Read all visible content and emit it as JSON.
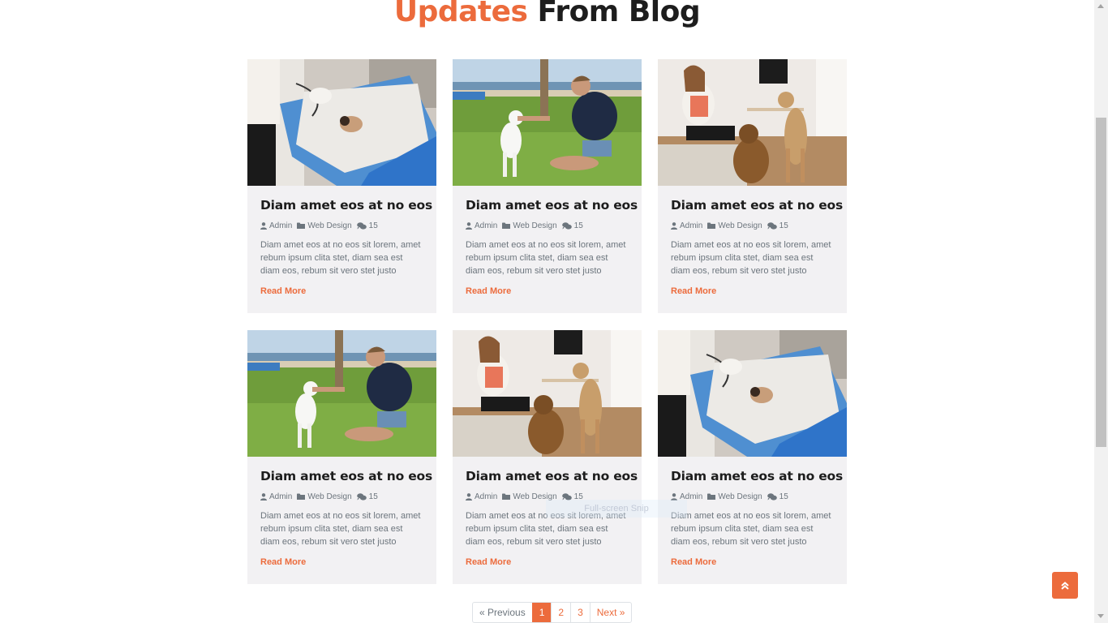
{
  "section": {
    "title_accent": "Updates",
    "title_rest": "From Blog"
  },
  "posts": [
    {
      "image": "vet-puppy",
      "title": "Diam amet eos at no eos",
      "author": "Admin",
      "category": "Web Design",
      "comments": "15",
      "excerpt": "Diam amet eos at no eos sit lorem, amet rebum ipsum clita stet, diam sea est diam eos, rebum sit vero stet justo",
      "link": "Read More"
    },
    {
      "image": "man-dog-beach",
      "title": "Diam amet eos at no eos",
      "author": "Admin",
      "category": "Web Design",
      "comments": "15",
      "excerpt": "Diam amet eos at no eos sit lorem, amet rebum ipsum clita stet, diam sea est diam eos, rebum sit vero stet justo",
      "link": "Read More"
    },
    {
      "image": "woman-dogs-room",
      "title": "Diam amet eos at no eos",
      "author": "Admin",
      "category": "Web Design",
      "comments": "15",
      "excerpt": "Diam amet eos at no eos sit lorem, amet rebum ipsum clita stet, diam sea est diam eos, rebum sit vero stet justo",
      "link": "Read More"
    },
    {
      "image": "man-dog-beach",
      "title": "Diam amet eos at no eos",
      "author": "Admin",
      "category": "Web Design",
      "comments": "15",
      "excerpt": "Diam amet eos at no eos sit lorem, amet rebum ipsum clita stet, diam sea est diam eos, rebum sit vero stet justo",
      "link": "Read More"
    },
    {
      "image": "woman-dogs-room",
      "title": "Diam amet eos at no eos",
      "author": "Admin",
      "category": "Web Design",
      "comments": "15",
      "excerpt": "Diam amet eos at no eos sit lorem, amet rebum ipsum clita stet, diam sea est diam eos, rebum sit vero stet justo",
      "link": "Read More"
    },
    {
      "image": "vet-puppy",
      "title": "Diam amet eos at no eos",
      "author": "Admin",
      "category": "Web Design",
      "comments": "15",
      "excerpt": "Diam amet eos at no eos sit lorem, amet rebum ipsum clita stet, diam sea est diam eos, rebum sit vero stet justo",
      "link": "Read More"
    }
  ],
  "pagination": {
    "previous": "« Previous",
    "pages": [
      "1",
      "2",
      "3"
    ],
    "active": "1",
    "next": "Next »"
  },
  "overlay": {
    "snip_label": "Full-screen Snip"
  },
  "icons": {
    "author": "user-icon",
    "category": "folder-icon",
    "comments": "comments-icon",
    "back_to_top": "double-chevron-up-icon"
  },
  "colors": {
    "accent": "#ec6b3c",
    "heading": "#1d1d1d",
    "card_bg": "#f2f1f3",
    "text_muted": "#6c757d"
  }
}
